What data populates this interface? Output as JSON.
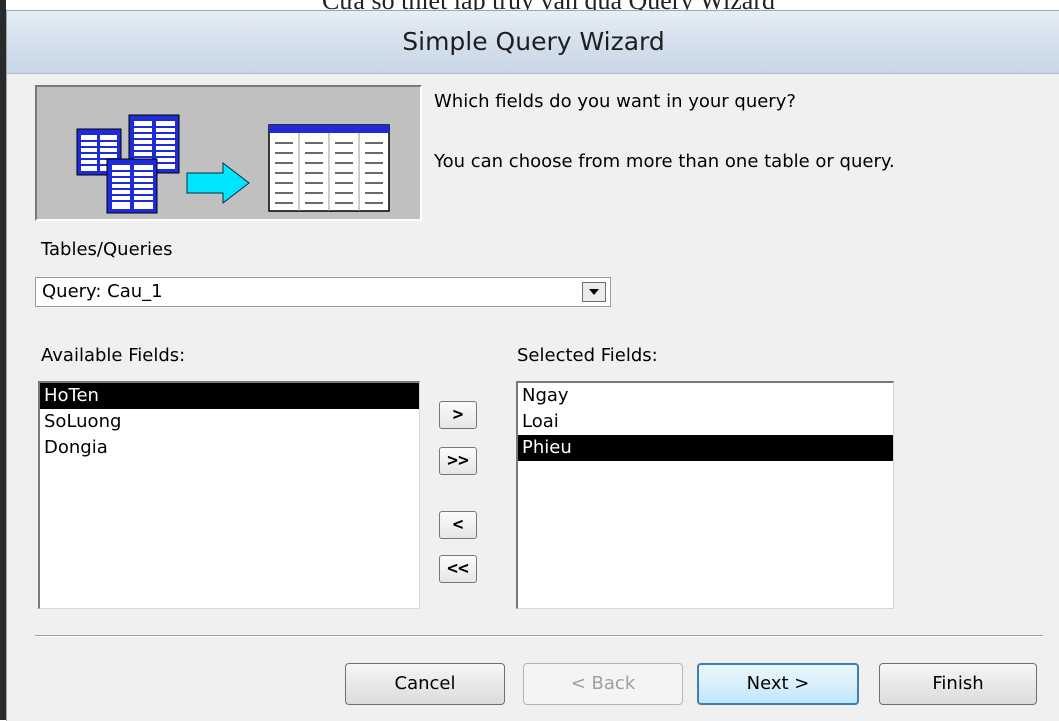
{
  "caption": "Cửa sổ thiết lập truy vấn qua Query Wizard",
  "dialog": {
    "title": "Simple Query Wizard",
    "prompt_line1": "Which fields do you want in your query?",
    "prompt_line2": "You can choose from more than one table or query."
  },
  "tables_queries": {
    "label": "Tables/Queries",
    "value": "Query: Cau_1"
  },
  "available_fields": {
    "label": "Available Fields:",
    "items": [
      "HoTen",
      "SoLuong",
      "Dongia"
    ],
    "selected": "HoTen"
  },
  "selected_fields": {
    "label": "Selected Fields:",
    "items": [
      "Ngay",
      "Loai",
      "Phieu"
    ],
    "selected": "Phieu"
  },
  "move_buttons": {
    "add_one": ">",
    "add_all": ">>",
    "remove_one": "<",
    "remove_all": "<<"
  },
  "footer": {
    "cancel": "Cancel",
    "back": "< Back",
    "next": "Next >",
    "finish": "Finish"
  },
  "icons": {
    "wizard_graphic": "tables-to-query-icon",
    "combo_arrow": "chevron-down-icon"
  },
  "colors": {
    "titlebar": "#d3dfec",
    "selection": "#000000",
    "arrow": "#00e5ff",
    "default_button_border": "#3c7fb1"
  }
}
